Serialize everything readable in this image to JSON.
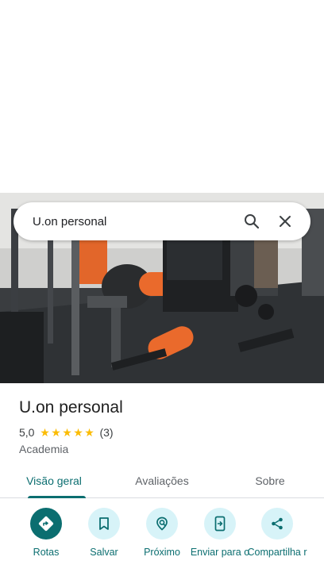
{
  "search": {
    "query": "U.on personal"
  },
  "place": {
    "name": "U.on personal",
    "rating": "5,0",
    "stars": 5,
    "review_count": "(3)",
    "category": "Academia"
  },
  "tabs": [
    {
      "label": "Visão geral",
      "active": true
    },
    {
      "label": "Avaliações",
      "active": false
    },
    {
      "label": "Sobre",
      "active": false
    }
  ],
  "actions": [
    {
      "label": "Rotas",
      "icon": "directions-icon"
    },
    {
      "label": "Salvar",
      "icon": "bookmark-icon"
    },
    {
      "label": "Próximo",
      "icon": "nearby-icon"
    },
    {
      "label": "Enviar para o",
      "icon": "send-to-phone-icon"
    },
    {
      "label": "Compartilha r",
      "icon": "share-icon"
    }
  ],
  "colors": {
    "accent": "#0b6e70",
    "action_bg": "#d7f3f8",
    "star": "#fbbc04"
  }
}
